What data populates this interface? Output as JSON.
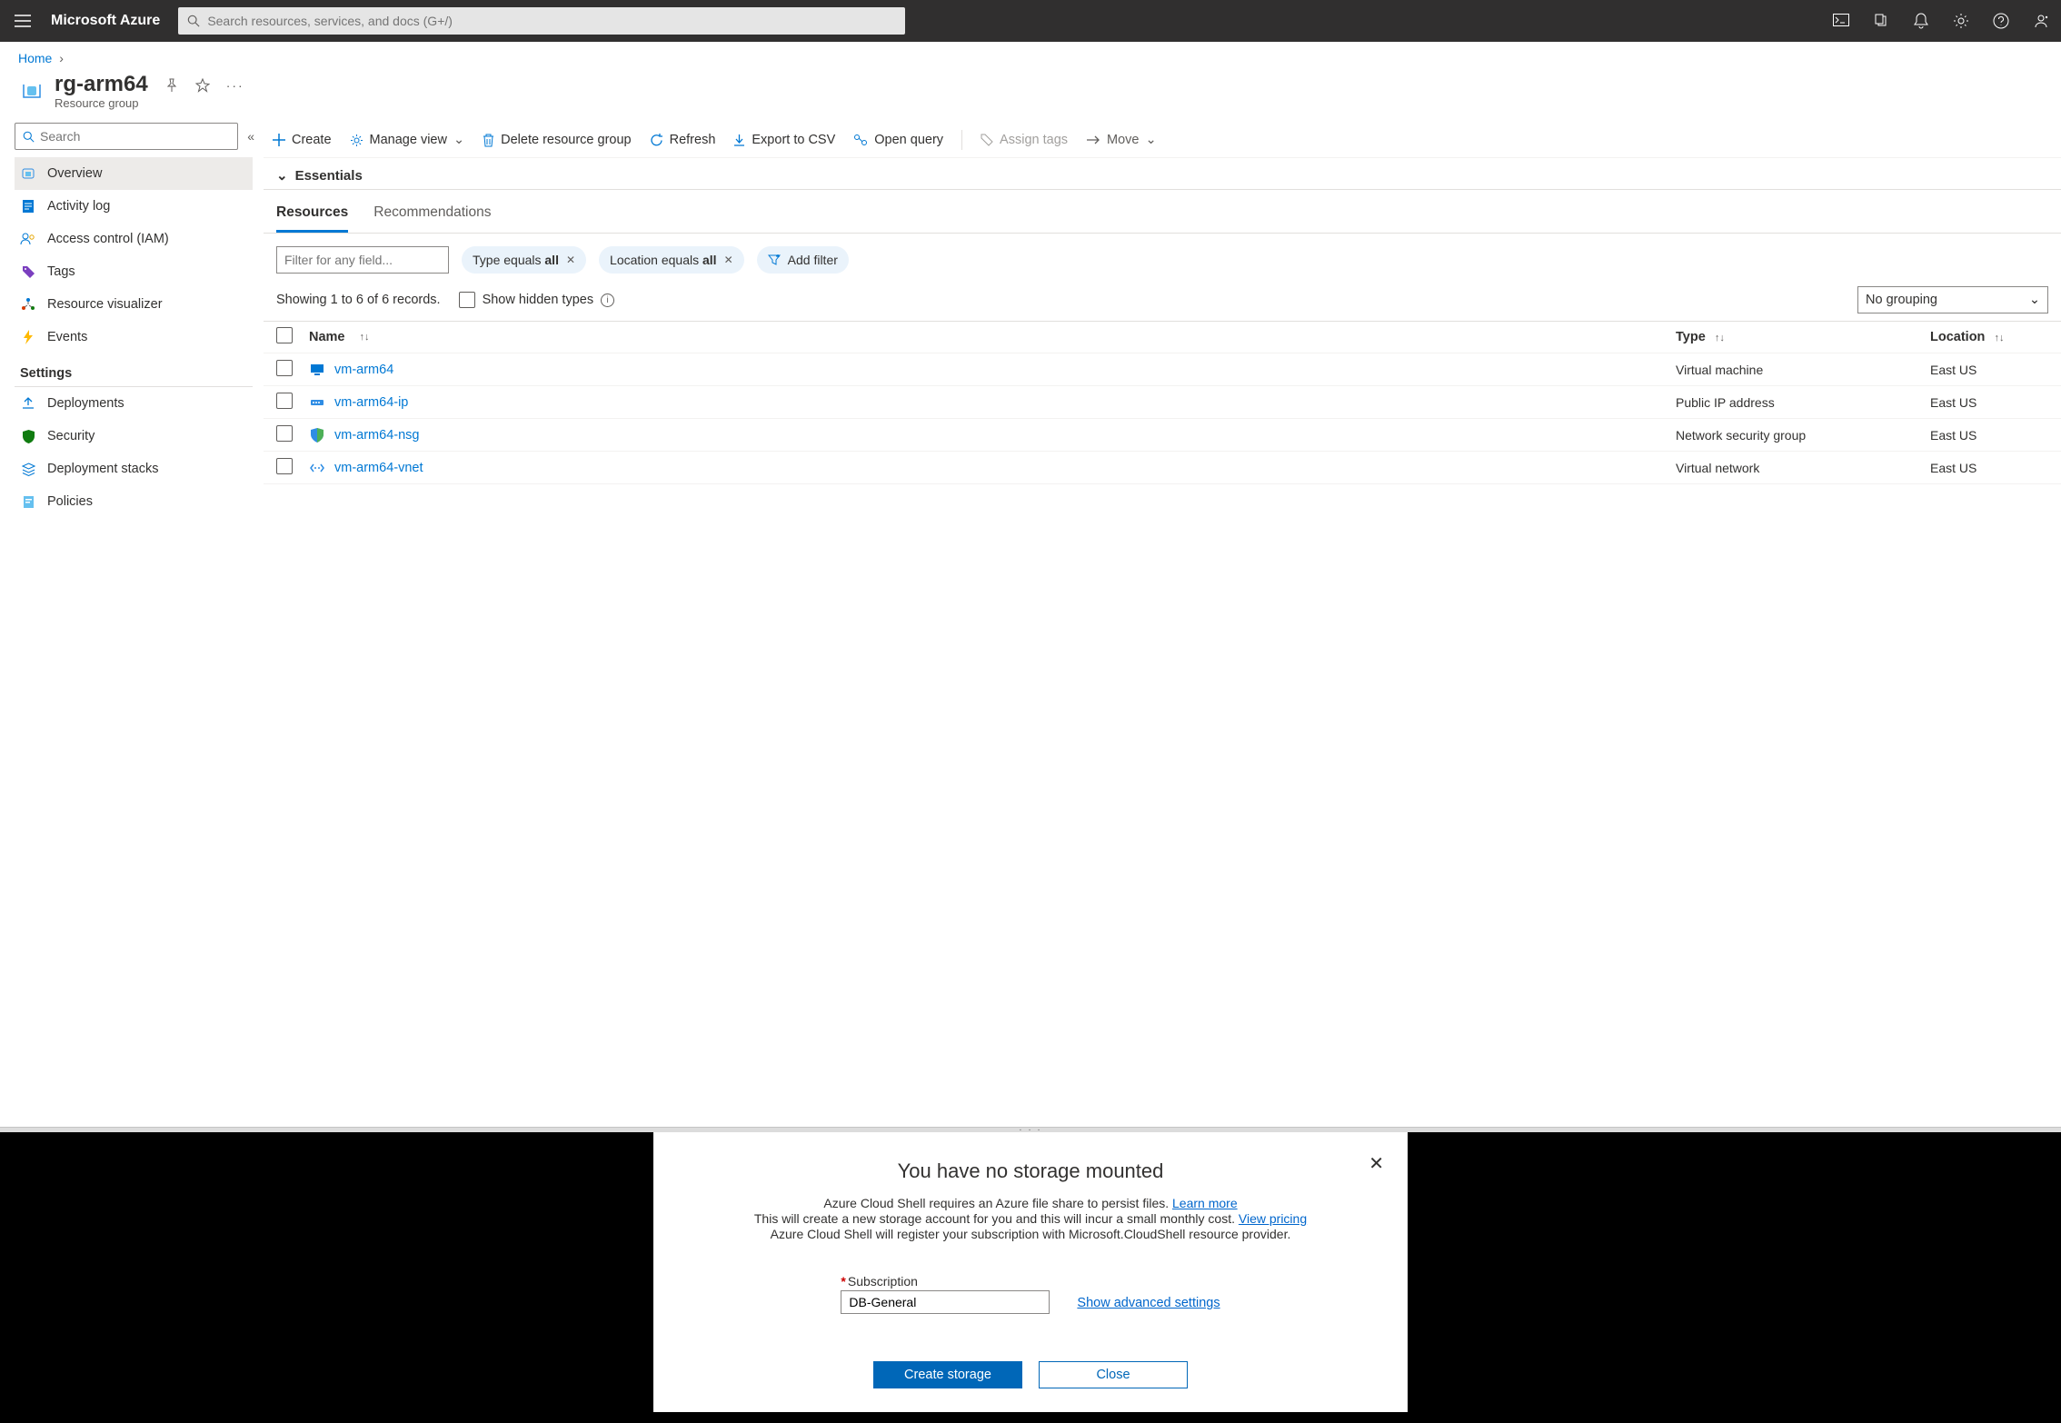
{
  "header": {
    "brand": "Microsoft Azure",
    "search_placeholder": "Search resources, services, and docs (G+/)"
  },
  "breadcrumb": {
    "home": "Home"
  },
  "page": {
    "title": "rg-arm64",
    "subtitle": "Resource group"
  },
  "sidebar": {
    "search_placeholder": "Search",
    "items": [
      {
        "label": "Overview",
        "icon": "overview"
      },
      {
        "label": "Activity log",
        "icon": "log"
      },
      {
        "label": "Access control (IAM)",
        "icon": "people"
      },
      {
        "label": "Tags",
        "icon": "tag"
      },
      {
        "label": "Resource visualizer",
        "icon": "viz"
      },
      {
        "label": "Events",
        "icon": "lightning"
      }
    ],
    "settings_heading": "Settings",
    "settings": [
      {
        "label": "Deployments",
        "icon": "deploy"
      },
      {
        "label": "Security",
        "icon": "security"
      },
      {
        "label": "Deployment stacks",
        "icon": "stacks"
      },
      {
        "label": "Policies",
        "icon": "policy"
      }
    ]
  },
  "commands": {
    "create": "Create",
    "manage_view": "Manage view",
    "delete": "Delete resource group",
    "refresh": "Refresh",
    "export_csv": "Export to CSV",
    "open_query": "Open query",
    "assign_tags": "Assign tags",
    "move": "Move"
  },
  "essentials_label": "Essentials",
  "tabs": {
    "resources": "Resources",
    "recommendations": "Recommendations"
  },
  "filters": {
    "field_placeholder": "Filter for any field...",
    "pill_type_prefix": "Type equals ",
    "pill_type_value": "all",
    "pill_loc_prefix": "Location equals ",
    "pill_loc_value": "all",
    "add_filter": "Add filter"
  },
  "records_text": "Showing 1 to 6 of 6 records.",
  "hidden_types_label": "Show hidden types",
  "grouping_value": "No grouping",
  "table": {
    "col_name": "Name",
    "col_type": "Type",
    "col_loc": "Location",
    "rows": [
      {
        "name": "vm-arm64",
        "type": "Virtual machine",
        "location": "East US",
        "icon": "vm"
      },
      {
        "name": "vm-arm64-ip",
        "type": "Public IP address",
        "location": "East US",
        "icon": "ip"
      },
      {
        "name": "vm-arm64-nsg",
        "type": "Network security group",
        "location": "East US",
        "icon": "shield"
      },
      {
        "name": "vm-arm64-vnet",
        "type": "Virtual network",
        "location": "East US",
        "icon": "vnet"
      }
    ]
  },
  "shell": {
    "title": "You have no storage mounted",
    "line1a": "Azure Cloud Shell requires an Azure file share to persist files. ",
    "line1b": "Learn more",
    "line2a": "This will create a new storage account for you and this will incur a small monthly cost. ",
    "line2b": "View pricing",
    "line3": "Azure Cloud Shell will register your subscription with Microsoft.CloudShell resource provider.",
    "sub_label": "Subscription",
    "sub_value": "DB-General",
    "adv_link": "Show advanced settings",
    "create_btn": "Create storage",
    "close_btn": "Close"
  }
}
